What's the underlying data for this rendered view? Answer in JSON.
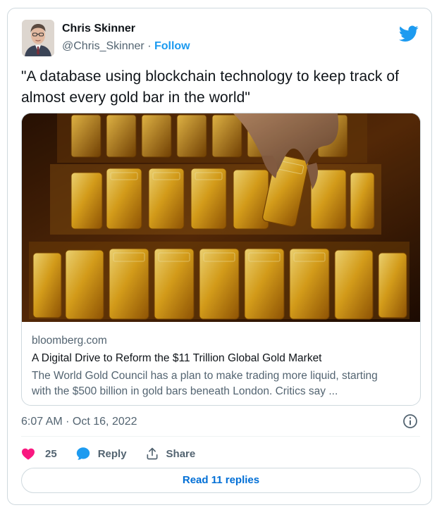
{
  "author": {
    "name": "Chris Skinner",
    "handle": "@Chris_Skinner",
    "separator": "·",
    "follow_label": "Follow"
  },
  "tweet": {
    "text": "\"A database using blockchain technology to keep track of almost every gold bar in the world\""
  },
  "link_card": {
    "domain": "bloomberg.com",
    "title": "A Digital Drive to Reform the $11 Trillion Global Gold Market",
    "description": "The World Gold Council has a plan to make trading more liquid, starting with the $500 billion in gold bars beneath London. Critics say ..."
  },
  "meta": {
    "timestamp": "6:07 AM · Oct 16, 2022"
  },
  "actions": {
    "like_count": "25",
    "reply_label": "Reply",
    "share_label": "Share",
    "read_replies_label": "Read 11 replies"
  },
  "icons": {
    "brand": "twitter-bird-icon",
    "like": "heart-icon",
    "reply": "speech-bubble-icon",
    "share": "share-upload-icon",
    "info": "info-icon"
  },
  "colors": {
    "brand_blue": "#1d9bf0",
    "like_pink": "#f91880",
    "text_primary": "#0f1419",
    "text_secondary": "#536471",
    "border": "#cfd9de",
    "link_blue": "#006fd6"
  }
}
